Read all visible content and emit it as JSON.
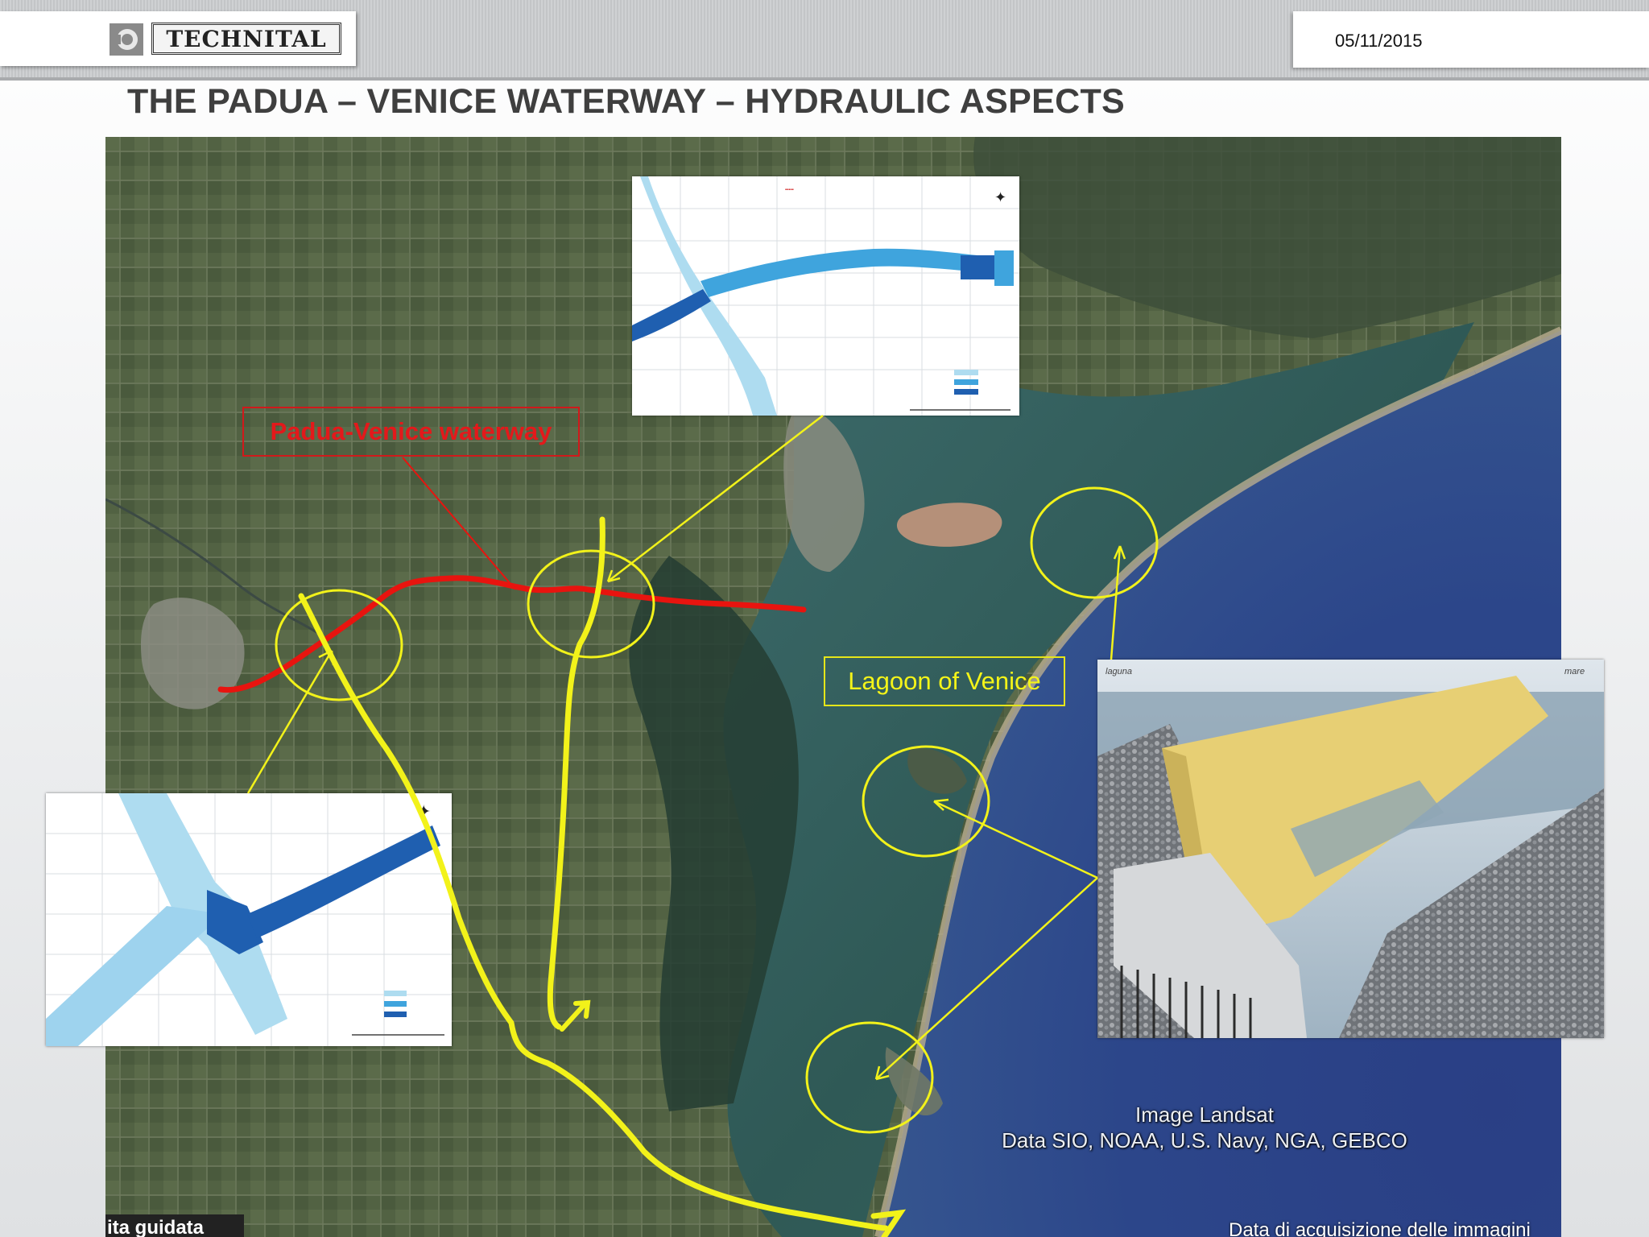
{
  "header": {
    "logo_text": "TECHNITAL",
    "date": "05/11/2015"
  },
  "title": "THE PADUA – VENICE WATERWAY – HYDRAULIC ASPECTS",
  "map": {
    "waterway_label": "Padua-Venice waterway",
    "lagoon_label": "Lagoon of Venice",
    "image_credit_line1": "Image Landsat",
    "image_credit_line2": "Data SIO, NOAA, U.S. Navy, NGA, GEBCO",
    "bottom_left_text": "ita guidata",
    "bottom_right_text": "Data di acquisizione delle immagini",
    "colors": {
      "waterway": "#e8140f",
      "highlight": "#f2f21a",
      "sea": "#283f84",
      "land": "#4a5a3c",
      "lagoon": "#2f5a58"
    }
  },
  "insets": {
    "top_plan": "canal plan detail – east junction",
    "left_plan": "canal plan detail – west junction",
    "barrier_3d": "tidal gate 3D section"
  }
}
